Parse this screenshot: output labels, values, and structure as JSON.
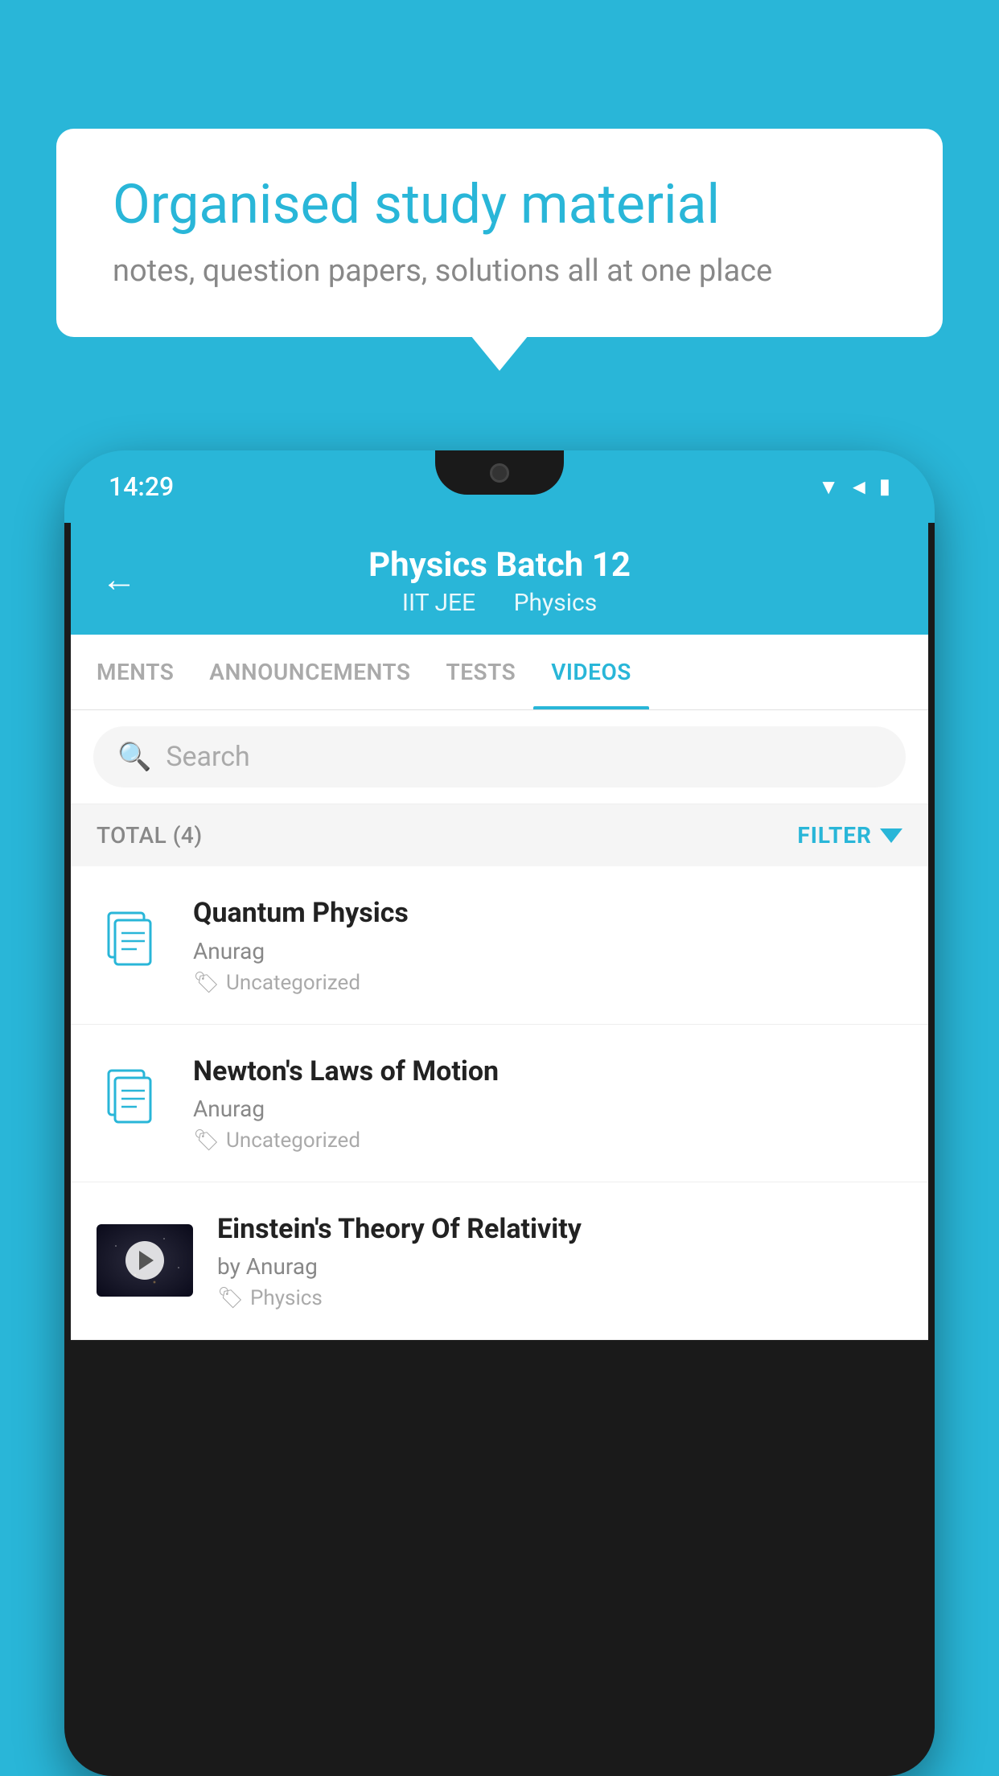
{
  "background_color": "#29b6d8",
  "speech_bubble": {
    "title": "Organised study material",
    "subtitle": "notes, question papers, solutions all at one place"
  },
  "phone": {
    "status_bar": {
      "time": "14:29"
    },
    "header": {
      "title": "Physics Batch 12",
      "subtitle_part1": "IIT JEE",
      "subtitle_part2": "Physics",
      "back_label": "←"
    },
    "tabs": [
      {
        "label": "MENTS",
        "active": false
      },
      {
        "label": "ANNOUNCEMENTS",
        "active": false
      },
      {
        "label": "TESTS",
        "active": false
      },
      {
        "label": "VIDEOS",
        "active": true
      }
    ],
    "search": {
      "placeholder": "Search"
    },
    "filter_bar": {
      "total_label": "TOTAL (4)",
      "filter_label": "FILTER"
    },
    "videos": [
      {
        "id": 1,
        "title": "Quantum Physics",
        "author": "Anurag",
        "tag": "Uncategorized",
        "has_thumbnail": false
      },
      {
        "id": 2,
        "title": "Newton's Laws of Motion",
        "author": "Anurag",
        "tag": "Uncategorized",
        "has_thumbnail": false
      },
      {
        "id": 3,
        "title": "Einstein's Theory Of Relativity",
        "author": "by Anurag",
        "tag": "Physics",
        "has_thumbnail": true
      }
    ]
  }
}
